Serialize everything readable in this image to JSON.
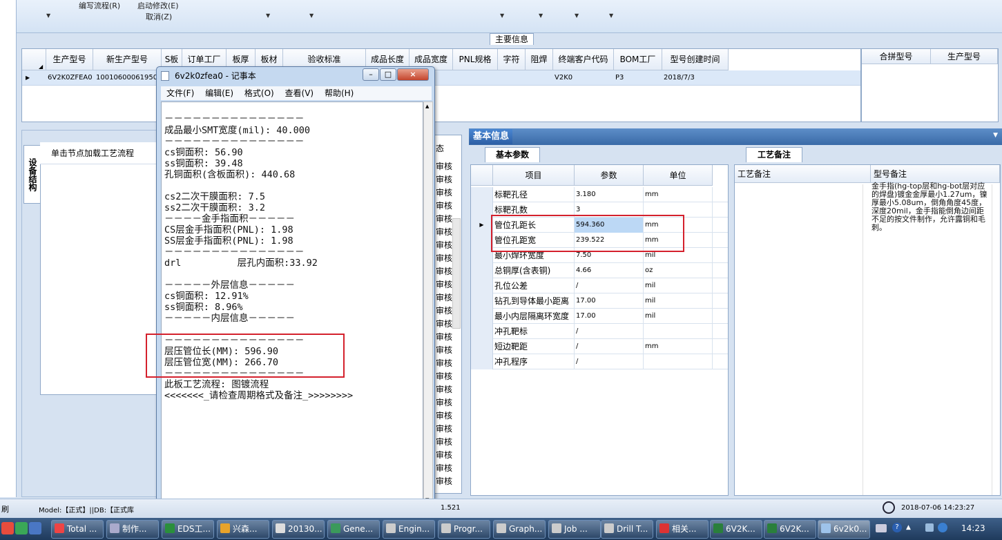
{
  "menu": {
    "items": [
      "编写流程(R)",
      "启动修改(E)",
      "取消(Z)"
    ]
  },
  "main_info": {
    "tab_label": "主要信息",
    "columns": [
      "生产型号",
      "新生产型号",
      "S板",
      "订单工厂",
      "板厚",
      "板材",
      "验收标准",
      "成品长度",
      "成品宽度",
      "PNL规格",
      "字符",
      "阻焊",
      "终端客户代码",
      "BOM工厂",
      "型号创建时间"
    ],
    "row": {
      "production_model": "6V2K0ZFEA0",
      "new_model": "10010600061950",
      "customer_code": "V2K0",
      "bom_factory": "P3",
      "created": "2018/7/3"
    },
    "right_columns": [
      "合拼型号",
      "生产型号"
    ]
  },
  "left_panel": {
    "vertical_tab": "设备结构",
    "tree_header": "单击节点加载工艺流程"
  },
  "mid_column": {
    "header": "态",
    "cell_text": "审核"
  },
  "notepad": {
    "title": "6v2k0zfea0 - 记事本",
    "menu": [
      "文件(F)",
      "编辑(E)",
      "格式(O)",
      "查看(V)",
      "帮助(H)"
    ],
    "buttons": [
      "–",
      "□",
      "×"
    ],
    "lines": [
      "－－－－－－－－－－－－－－－",
      "成品最小SMT宽度(mil): 40.000",
      "－－－－－－－－－－－－－－－",
      "cs铜面积: 56.90",
      "ss铜面积: 39.48",
      "孔铜面积(含板面积): 440.68",
      "",
      "cs2二次干膜面积: 7.5",
      "ss2二次干膜面积: 3.2",
      "－－－－金手指面积－－－－－",
      "CS层金手指面积(PNL): 1.98",
      "SS层金手指面积(PNL): 1.98",
      "－－－－－－－－－－－－－－－",
      "drl          层孔内面积:33.92",
      "",
      "－－－－－外层信息－－－－－",
      "cs铜面积: 12.91%",
      "ss铜面积: 8.96%",
      "－－－－－内层信息－－－－－",
      "",
      "－－－－－－－－－－－－－－－",
      "层压管位长(MM): 596.90",
      "层压管位宽(MM): 266.70",
      "－－－－－－－－－－－－－－－",
      "此板工艺流程: 图镀流程",
      "<<<<<<<_请检查周期格式及备注_>>>>>>>>"
    ]
  },
  "basic_info": {
    "tab": "基本信息",
    "sub_tab": "基本参数",
    "columns": [
      "项目",
      "参数",
      "单位"
    ],
    "rows": [
      {
        "name": "标靶孔径",
        "value": "3.180",
        "unit": "mm"
      },
      {
        "name": "标靶孔数",
        "value": "3",
        "unit": ""
      },
      {
        "name": "管位孔距长",
        "value": "594.360",
        "unit": "mm"
      },
      {
        "name": "管位孔距宽",
        "value": "239.522",
        "unit": "mm"
      },
      {
        "name": "最小焊环宽度",
        "value": "7.50",
        "unit": "mil"
      },
      {
        "name": "总铜厚(含表铜)",
        "value": "4.66",
        "unit": "oz"
      },
      {
        "name": "孔位公差",
        "value": "/",
        "unit": "mil"
      },
      {
        "name": "钻孔到导体最小距离",
        "value": "17.00",
        "unit": "mil"
      },
      {
        "name": "最小内层隔离环宽度",
        "value": "17.00",
        "unit": "mil"
      },
      {
        "name": "冲孔靶标",
        "value": "/",
        "unit": ""
      },
      {
        "name": "短边靶距",
        "value": "/",
        "unit": "mm"
      },
      {
        "name": "冲孔程序",
        "value": "/",
        "unit": ""
      }
    ]
  },
  "craft": {
    "tab": "工艺备注",
    "columns": [
      "工艺备注",
      "型号备注"
    ],
    "model_note": "金手指(hg-top层和hg-bot层对应的焊盘)镀金金厚最小1.27um，镍厚最小5.08um，倒角角度45度，深度20mil，金手指能倒角边间距不足的按文件制作，允许露铜和毛刺。"
  },
  "status": {
    "left_char": "刷",
    "model_text": "Model:【正式】||DB:【正式库",
    "mid_value": "1.521",
    "datetime": "2018-07-06 14:23:27"
  },
  "taskbar": {
    "items": [
      "Total ...",
      "制作...",
      "EDS工...",
      "兴森...",
      "20130...",
      "Gene...",
      "Engin...",
      "Progr...",
      "Graph...",
      "Job ...",
      "Drill T...",
      "相关...",
      "6V2K...",
      "6V2K...",
      "6v2k0..."
    ],
    "clock": "14:23"
  }
}
